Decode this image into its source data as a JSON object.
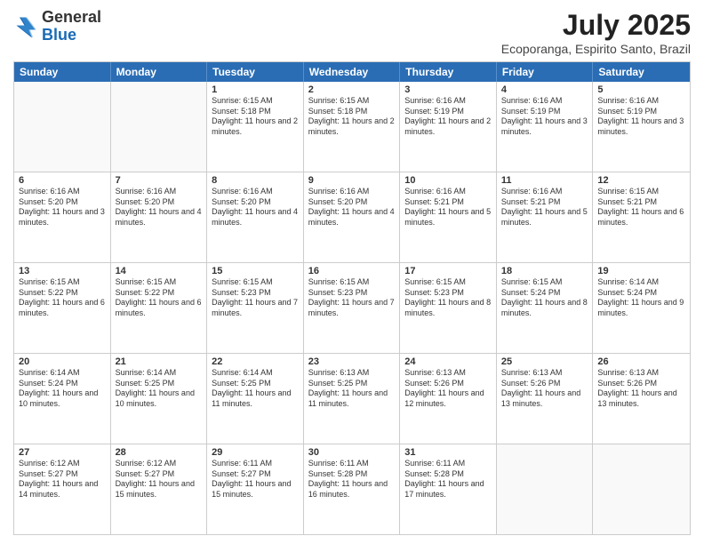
{
  "header": {
    "logo_general": "General",
    "logo_blue": "Blue",
    "month_year": "July 2025",
    "location": "Ecoporanga, Espirito Santo, Brazil"
  },
  "days_of_week": [
    "Sunday",
    "Monday",
    "Tuesday",
    "Wednesday",
    "Thursday",
    "Friday",
    "Saturday"
  ],
  "weeks": [
    [
      {
        "day": "",
        "sunrise": "",
        "sunset": "",
        "daylight": "",
        "empty": true
      },
      {
        "day": "",
        "sunrise": "",
        "sunset": "",
        "daylight": "",
        "empty": true
      },
      {
        "day": "1",
        "sunrise": "Sunrise: 6:15 AM",
        "sunset": "Sunset: 5:18 PM",
        "daylight": "Daylight: 11 hours and 2 minutes."
      },
      {
        "day": "2",
        "sunrise": "Sunrise: 6:15 AM",
        "sunset": "Sunset: 5:18 PM",
        "daylight": "Daylight: 11 hours and 2 minutes."
      },
      {
        "day": "3",
        "sunrise": "Sunrise: 6:16 AM",
        "sunset": "Sunset: 5:19 PM",
        "daylight": "Daylight: 11 hours and 2 minutes."
      },
      {
        "day": "4",
        "sunrise": "Sunrise: 6:16 AM",
        "sunset": "Sunset: 5:19 PM",
        "daylight": "Daylight: 11 hours and 3 minutes."
      },
      {
        "day": "5",
        "sunrise": "Sunrise: 6:16 AM",
        "sunset": "Sunset: 5:19 PM",
        "daylight": "Daylight: 11 hours and 3 minutes."
      }
    ],
    [
      {
        "day": "6",
        "sunrise": "Sunrise: 6:16 AM",
        "sunset": "Sunset: 5:20 PM",
        "daylight": "Daylight: 11 hours and 3 minutes."
      },
      {
        "day": "7",
        "sunrise": "Sunrise: 6:16 AM",
        "sunset": "Sunset: 5:20 PM",
        "daylight": "Daylight: 11 hours and 4 minutes."
      },
      {
        "day": "8",
        "sunrise": "Sunrise: 6:16 AM",
        "sunset": "Sunset: 5:20 PM",
        "daylight": "Daylight: 11 hours and 4 minutes."
      },
      {
        "day": "9",
        "sunrise": "Sunrise: 6:16 AM",
        "sunset": "Sunset: 5:20 PM",
        "daylight": "Daylight: 11 hours and 4 minutes."
      },
      {
        "day": "10",
        "sunrise": "Sunrise: 6:16 AM",
        "sunset": "Sunset: 5:21 PM",
        "daylight": "Daylight: 11 hours and 5 minutes."
      },
      {
        "day": "11",
        "sunrise": "Sunrise: 6:16 AM",
        "sunset": "Sunset: 5:21 PM",
        "daylight": "Daylight: 11 hours and 5 minutes."
      },
      {
        "day": "12",
        "sunrise": "Sunrise: 6:15 AM",
        "sunset": "Sunset: 5:21 PM",
        "daylight": "Daylight: 11 hours and 6 minutes."
      }
    ],
    [
      {
        "day": "13",
        "sunrise": "Sunrise: 6:15 AM",
        "sunset": "Sunset: 5:22 PM",
        "daylight": "Daylight: 11 hours and 6 minutes."
      },
      {
        "day": "14",
        "sunrise": "Sunrise: 6:15 AM",
        "sunset": "Sunset: 5:22 PM",
        "daylight": "Daylight: 11 hours and 6 minutes."
      },
      {
        "day": "15",
        "sunrise": "Sunrise: 6:15 AM",
        "sunset": "Sunset: 5:23 PM",
        "daylight": "Daylight: 11 hours and 7 minutes."
      },
      {
        "day": "16",
        "sunrise": "Sunrise: 6:15 AM",
        "sunset": "Sunset: 5:23 PM",
        "daylight": "Daylight: 11 hours and 7 minutes."
      },
      {
        "day": "17",
        "sunrise": "Sunrise: 6:15 AM",
        "sunset": "Sunset: 5:23 PM",
        "daylight": "Daylight: 11 hours and 8 minutes."
      },
      {
        "day": "18",
        "sunrise": "Sunrise: 6:15 AM",
        "sunset": "Sunset: 5:24 PM",
        "daylight": "Daylight: 11 hours and 8 minutes."
      },
      {
        "day": "19",
        "sunrise": "Sunrise: 6:14 AM",
        "sunset": "Sunset: 5:24 PM",
        "daylight": "Daylight: 11 hours and 9 minutes."
      }
    ],
    [
      {
        "day": "20",
        "sunrise": "Sunrise: 6:14 AM",
        "sunset": "Sunset: 5:24 PM",
        "daylight": "Daylight: 11 hours and 10 minutes."
      },
      {
        "day": "21",
        "sunrise": "Sunrise: 6:14 AM",
        "sunset": "Sunset: 5:25 PM",
        "daylight": "Daylight: 11 hours and 10 minutes."
      },
      {
        "day": "22",
        "sunrise": "Sunrise: 6:14 AM",
        "sunset": "Sunset: 5:25 PM",
        "daylight": "Daylight: 11 hours and 11 minutes."
      },
      {
        "day": "23",
        "sunrise": "Sunrise: 6:13 AM",
        "sunset": "Sunset: 5:25 PM",
        "daylight": "Daylight: 11 hours and 11 minutes."
      },
      {
        "day": "24",
        "sunrise": "Sunrise: 6:13 AM",
        "sunset": "Sunset: 5:26 PM",
        "daylight": "Daylight: 11 hours and 12 minutes."
      },
      {
        "day": "25",
        "sunrise": "Sunrise: 6:13 AM",
        "sunset": "Sunset: 5:26 PM",
        "daylight": "Daylight: 11 hours and 13 minutes."
      },
      {
        "day": "26",
        "sunrise": "Sunrise: 6:13 AM",
        "sunset": "Sunset: 5:26 PM",
        "daylight": "Daylight: 11 hours and 13 minutes."
      }
    ],
    [
      {
        "day": "27",
        "sunrise": "Sunrise: 6:12 AM",
        "sunset": "Sunset: 5:27 PM",
        "daylight": "Daylight: 11 hours and 14 minutes."
      },
      {
        "day": "28",
        "sunrise": "Sunrise: 6:12 AM",
        "sunset": "Sunset: 5:27 PM",
        "daylight": "Daylight: 11 hours and 15 minutes."
      },
      {
        "day": "29",
        "sunrise": "Sunrise: 6:11 AM",
        "sunset": "Sunset: 5:27 PM",
        "daylight": "Daylight: 11 hours and 15 minutes."
      },
      {
        "day": "30",
        "sunrise": "Sunrise: 6:11 AM",
        "sunset": "Sunset: 5:28 PM",
        "daylight": "Daylight: 11 hours and 16 minutes."
      },
      {
        "day": "31",
        "sunrise": "Sunrise: 6:11 AM",
        "sunset": "Sunset: 5:28 PM",
        "daylight": "Daylight: 11 hours and 17 minutes."
      },
      {
        "day": "",
        "sunrise": "",
        "sunset": "",
        "daylight": "",
        "empty": true
      },
      {
        "day": "",
        "sunrise": "",
        "sunset": "",
        "daylight": "",
        "empty": true
      }
    ]
  ]
}
